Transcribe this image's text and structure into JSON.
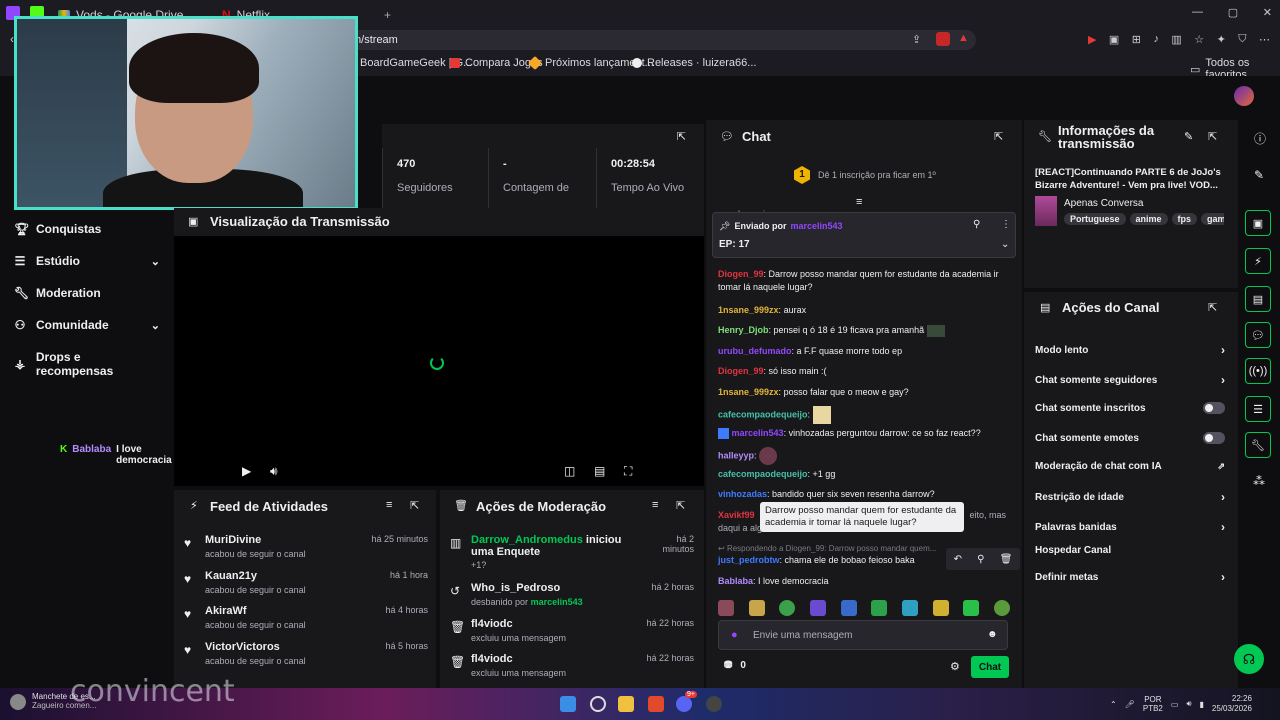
{
  "browser": {
    "tabs": [
      {
        "label": "Vods - Google Drive"
      },
      {
        "label": "Netflix"
      }
    ],
    "new_tab": "+",
    "url": "m/stream",
    "bookmarks": [
      "BoardGameGeek | G...",
      "Compara Jogos",
      "Próximos lançament...",
      "Releases · luizera66..."
    ],
    "all_favorites": "Todos os favoritos"
  },
  "nav": {
    "items": [
      {
        "label": "Conquistas",
        "icon": "trophy-icon"
      },
      {
        "label": "Estúdio",
        "icon": "grid-icon",
        "expandable": true
      },
      {
        "label": "Moderation",
        "icon": "wrench-icon"
      },
      {
        "label": "Comunidade",
        "icon": "community-icon",
        "expandable": true
      },
      {
        "label": "Drops e recompensas",
        "icon": "drops-icon"
      }
    ]
  },
  "overlay_chat": {
    "user": "Bablaba",
    "text": "I love democracia"
  },
  "stats": [
    {
      "value": "470",
      "label": "Seguidores"
    },
    {
      "value": "-",
      "label": "Contagem de"
    },
    {
      "value": "00:28:54",
      "label": "Tempo Ao Vivo"
    }
  ],
  "video": {
    "title": "Visualização da Transmissão"
  },
  "feed": {
    "title": "Feed de Atividades",
    "items": [
      {
        "name": "MuriDivine",
        "sub": "acabou de seguir o canal",
        "time": "há 25 minutos"
      },
      {
        "name": "Kauan21y",
        "sub": "acabou de seguir o canal",
        "time": "há 1 hora"
      },
      {
        "name": "AkiraWf",
        "sub": "acabou de seguir o canal",
        "time": "há 4 horas"
      },
      {
        "name": "VictorVictoros",
        "sub": "acabou de seguir o canal",
        "time": "há 5 horas"
      }
    ]
  },
  "moderation": {
    "title": "Ações de Moderação",
    "items": [
      {
        "name": "Darrow_Andromedus",
        "action": "iniciou uma Enquete",
        "sub": "+1?",
        "time": "há 2 minutos",
        "icon": "poll-icon"
      },
      {
        "name": "Who_is_Pedroso",
        "sub": "desbanido por",
        "sub_user": "marcelin543",
        "time": "há 2 horas",
        "icon": "unban-icon"
      },
      {
        "name": "fl4viodc",
        "sub": "excluiu uma mensagem",
        "time": "há 22 horas",
        "icon": "trash-icon"
      },
      {
        "name": "fl4viodc",
        "sub": "excluiu uma mensagem",
        "time": "há 22 horas",
        "icon": "trash-icon"
      }
    ]
  },
  "chat": {
    "title": "Chat",
    "sub_goal": "Dê 1 inscrição pra ficar em 1º",
    "sub_goal_badge": "1",
    "cut_line": "marcha mais um ep",
    "pinned": {
      "by_label": "Enviado por",
      "by_user": "marcelin543",
      "text": "EP: 17"
    },
    "messages": [
      {
        "user": "Diogen_99",
        "color": "#e0343e",
        "text": "Darrow posso mandar quem for estudante da academia ir tomar lá naquele lugar?"
      },
      {
        "user": "1nsane_999zx",
        "color": "#e0b43a",
        "text": "aurax"
      },
      {
        "user": "Henry_Djob",
        "color": "#7ee07a",
        "text": "pensei q ó 18 é 19 ficava pra amanhã"
      },
      {
        "user": "urubu_defumado",
        "color": "#9147ff",
        "text": "a F.F quase morre todo ep"
      },
      {
        "user": "Diogen_99",
        "color": "#e0343e",
        "text": "só isso main :("
      },
      {
        "user": "1nsane_999zx",
        "color": "#e0b43a",
        "text": "posso falar que o meow e gay?"
      },
      {
        "user": "cafecompaodequeijo",
        "color": "#45c0a8",
        "text": ""
      },
      {
        "user": "marcelin543",
        "color": "#9147ff",
        "text": "vinhozadas perguntou darrow: ce so faz react??"
      },
      {
        "user": "halleyyp",
        "color": "#b18cff",
        "text": ""
      },
      {
        "user": "cafecompaodequeijo",
        "color": "#45c0a8",
        "text": "+1 gg"
      },
      {
        "user": "vinhozadas",
        "color": "#3e7bff",
        "text": "bandido quer six seven resenha darrow?"
      },
      {
        "user": "Xavikf99",
        "color": "#e0343e",
        "text": "daqui a algu...",
        "tail": "eito, mas"
      }
    ],
    "tooltip": "Darrow posso mandar quem for estudante da academia ir tomar lá naquele lugar?",
    "reply_ref": "Respondendo a Diogen_99: Darrow posso mandar quem...",
    "reply_msg": {
      "user": "just_pedrobtw",
      "color": "#3e7bff",
      "text": "chama ele de bobao feioso baka"
    },
    "last_msg": {
      "user": "Bablaba",
      "color": "#b18cff",
      "text": "I love democracia"
    },
    "input_placeholder": "Envie uma mensagem",
    "points": "0",
    "send_label": "Chat"
  },
  "info": {
    "title": "Informações da transmissão",
    "stream_title": "[REACT]Continuando PARTE 6 de JoJo's Bizarre Adventure! - Vem pra live! VOD...",
    "category": "Apenas Conversa",
    "tags": [
      "Portuguese",
      "anime",
      "fps",
      "gam"
    ]
  },
  "actions": {
    "title": "Ações do Canal",
    "items": [
      {
        "label": "Modo lento",
        "kind": "chevron"
      },
      {
        "label": "Chat somente seguidores",
        "kind": "chevron"
      },
      {
        "label": "Chat somente inscritos",
        "kind": "toggle"
      },
      {
        "label": "Chat somente emotes",
        "kind": "toggle"
      },
      {
        "label": "Moderação de chat com IA",
        "kind": "external"
      },
      {
        "label": "Restrição de idade",
        "kind": "chevron"
      },
      {
        "label": "Palavras banidas",
        "kind": "chevron"
      },
      {
        "label": "Hospedar Canal",
        "kind": "none"
      },
      {
        "label": "Definir metas",
        "kind": "chevron"
      }
    ]
  },
  "taskbar": {
    "news_title": "Manchete de es...",
    "news_sub": "Zagueiro comen...",
    "overlay_text": "convincent",
    "lang": "POR",
    "lang2": "PTB2",
    "time": "22:26",
    "date": "25/03/2026",
    "badge": "9+"
  },
  "colors": {
    "accent": "#9147ff",
    "green": "#00c853",
    "panel": "#18181b",
    "bg": "#0e0e10"
  }
}
